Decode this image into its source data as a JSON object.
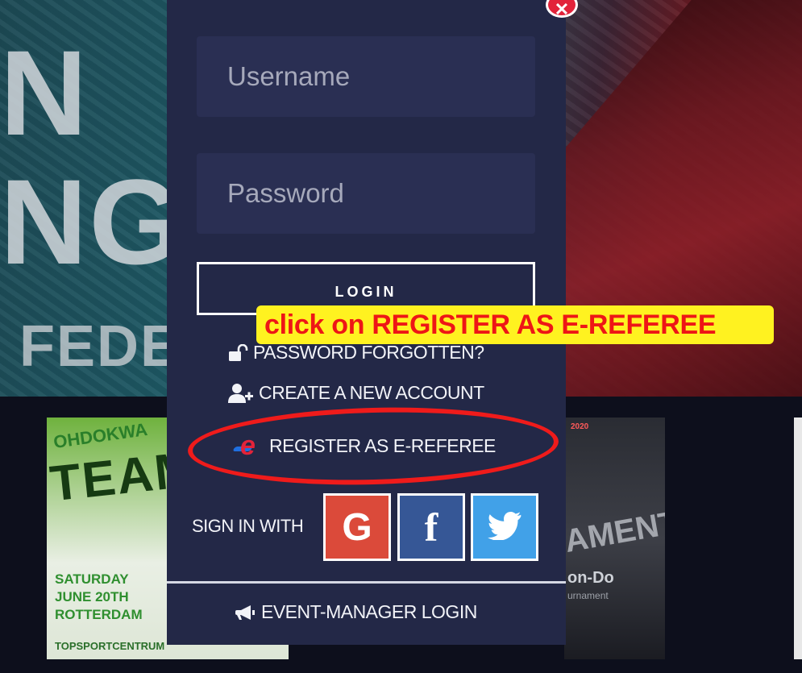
{
  "background": {
    "hero_letters": [
      "N",
      "NG",
      "FEDE"
    ],
    "card_left": {
      "brand": "OHDOKWA",
      "headline": "TEAM",
      "info": [
        "SATURDAY",
        "JUNE 20TH",
        "ROTTERDAM"
      ],
      "footer": "TOPSPORTCENTRUM"
    },
    "card_right": {
      "year": "2020",
      "headline": "AMENT",
      "subtitle": "on-Do",
      "caption": "urnament"
    }
  },
  "modal": {
    "close_glyph": "✕",
    "username_placeholder": "Username",
    "password_placeholder": "Password",
    "login_label": "LOGIN",
    "password_forgotten": "PASSWORD FORGOTTEN?",
    "create_account": "CREATE A NEW ACCOUNT",
    "register_referee": "REGISTER AS E-REFEREE",
    "sign_in_with": "SIGN IN WITH",
    "social": {
      "google": "G",
      "facebook": "f"
    },
    "event_manager": "EVENT-MANAGER LOGIN"
  },
  "annotation": {
    "callout_text": "click on REGISTER AS E-REFEREE"
  },
  "colors": {
    "modal_bg": "#232847",
    "field_bg": "#2a2f53",
    "google": "#db4a3a",
    "facebook": "#365796",
    "twitter": "#41a1e8",
    "callout_bg": "#fff220",
    "callout_text": "#ee1616",
    "ring": "#ef1b1b",
    "referee_red": "#e2233a"
  },
  "icons": {
    "password": "unlock-icon",
    "create": "add-user-icon",
    "referee": "e-referee-logo-icon",
    "twitter": "twitter-bird-icon",
    "event": "megaphone-icon",
    "close": "close-icon"
  }
}
